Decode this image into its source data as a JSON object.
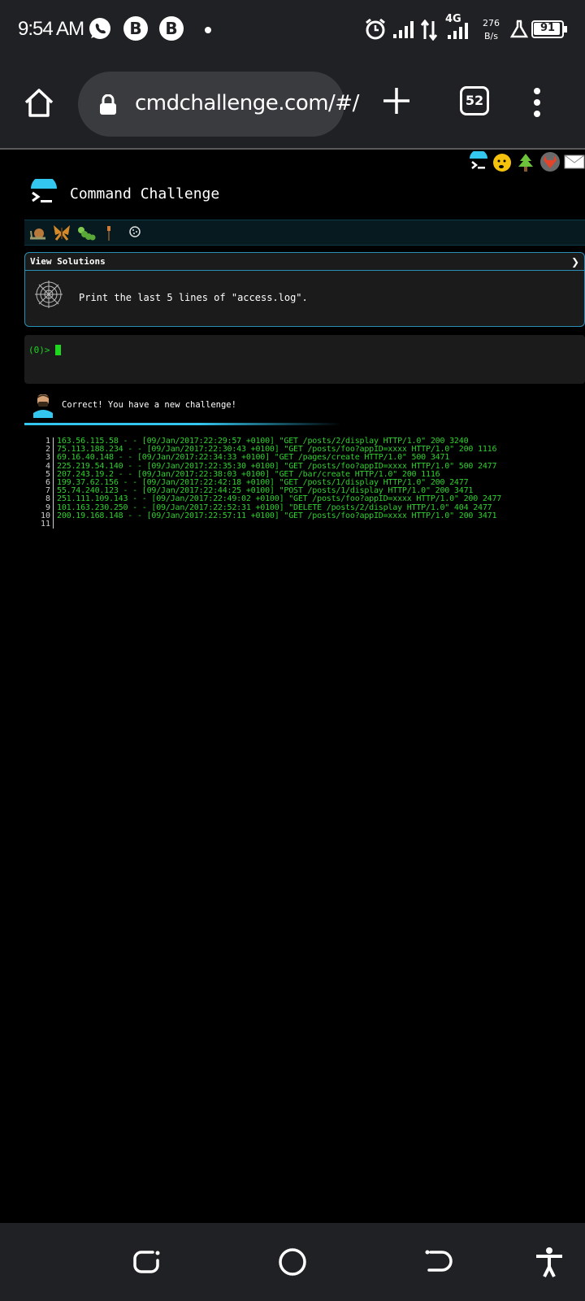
{
  "status_bar": {
    "time": "9:54 AM",
    "network_type": "4G",
    "speed_value": "276",
    "speed_unit": "B/s",
    "battery": "91",
    "icons": [
      "whatsapp-icon",
      "b-app-icon",
      "b-app-icon",
      "dot-icon",
      "alarm-icon",
      "signal-icon",
      "data-transfer-icon",
      "signal-4g-icon",
      "lab-icon",
      "battery-icon"
    ]
  },
  "browser": {
    "url": "cmdchallenge.com/#/",
    "tab_count": "52"
  },
  "page": {
    "title": "Command Challenge",
    "level_icons": [
      "snail",
      "moth",
      "caterpillar",
      "brush",
      "cookie"
    ],
    "challenge": {
      "header": "View Solutions",
      "chevron": "❯",
      "text": "Print the last 5 lines of \"access.log\"."
    },
    "terminal": {
      "prompt": "(0)>"
    },
    "result": {
      "message": "Correct! You have a new challenge!"
    },
    "output_lines": [
      {
        "n": "1",
        "text": "163.56.115.58 - - [09/Jan/2017:22:29:57 +0100] \"GET /posts/2/display HTTP/1.0\" 200 3240"
      },
      {
        "n": "2",
        "text": "75.113.188.234 - - [09/Jan/2017:22:30:43 +0100] \"GET /posts/foo?appID=xxxx HTTP/1.0\" 200 1116"
      },
      {
        "n": "3",
        "text": "69.16.40.148 - - [09/Jan/2017:22:34:33 +0100] \"GET /pages/create HTTP/1.0\" 500 3471"
      },
      {
        "n": "4",
        "text": "225.219.54.140 - - [09/Jan/2017:22:35:30 +0100] \"GET /posts/foo?appID=xxxx HTTP/1.0\" 500 2477"
      },
      {
        "n": "5",
        "text": "207.243.19.2 - - [09/Jan/2017:22:38:03 +0100] \"GET /bar/create HTTP/1.0\" 200 1116"
      },
      {
        "n": "6",
        "text": "199.37.62.156 - - [09/Jan/2017:22:42:18 +0100] \"GET /posts/1/display HTTP/1.0\" 200 2477"
      },
      {
        "n": "7",
        "text": "55.74.240.123 - - [09/Jan/2017:22:44:25 +0100] \"POST /posts/1/display HTTP/1.0\" 200 3471"
      },
      {
        "n": "8",
        "text": "251.111.109.143 - - [09/Jan/2017:22:49:02 +0100] \"GET /posts/foo?appID=xxxx HTTP/1.0\" 200 2477"
      },
      {
        "n": "9",
        "text": "101.163.230.250 - - [09/Jan/2017:22:52:31 +0100] \"DELETE /posts/2/display HTTP/1.0\" 404 2477"
      },
      {
        "n": "10",
        "text": "200.19.168.148 - - [09/Jan/2017:22:57:11 +0100] \"GET /posts/foo?appID=xxxx HTTP/1.0\" 200 3471"
      },
      {
        "n": "11",
        "text": ""
      }
    ]
  },
  "colors": {
    "accent": "#33c6ef",
    "terminal_green": "#2fd02f",
    "chrome_bg": "#202124"
  }
}
